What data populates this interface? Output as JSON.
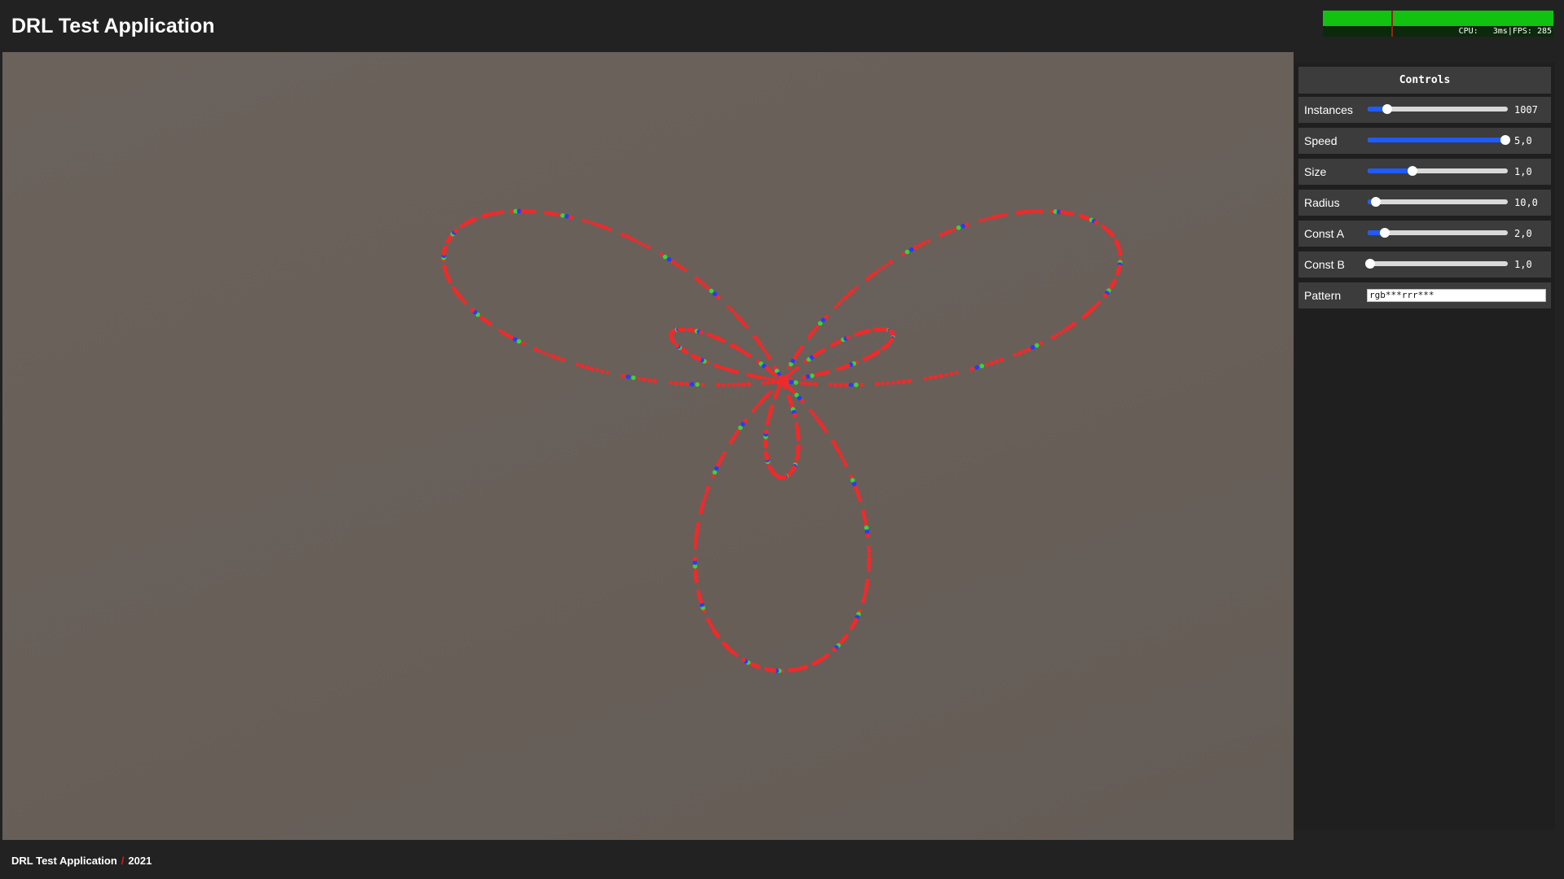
{
  "header": {
    "title": "DRL Test Application",
    "cpu_text": "CPU:   3ms|FPS: 285",
    "perf_fill_fraction": 1.0,
    "perf_color": "#11c211"
  },
  "viewport": {
    "background_color": "#675e58",
    "dot_colors": {
      "red": "#f02a2a",
      "green": "#39d439",
      "blue": "#2a3aff"
    },
    "curve": {
      "description_color_pattern": "rgb***rrr***"
    }
  },
  "controls": {
    "title": "Controls",
    "rows": [
      {
        "label": "Instances",
        "value": "1007",
        "fraction": 0.14
      },
      {
        "label": "Speed",
        "value": "5,0",
        "fraction": 0.98
      },
      {
        "label": "Size",
        "value": "1,0",
        "fraction": 0.32
      },
      {
        "label": "Radius",
        "value": "10,0",
        "fraction": 0.06
      },
      {
        "label": "Const A",
        "value": "2,0",
        "fraction": 0.12
      },
      {
        "label": "Const B",
        "value": "1,0",
        "fraction": 0.02
      }
    ],
    "pattern": {
      "label": "Pattern",
      "value": "rgb***rrr***"
    },
    "accent_color": "#1f5bff"
  },
  "footer": {
    "app_name": "DRL Test Application",
    "separator": "/",
    "year": "2021"
  }
}
